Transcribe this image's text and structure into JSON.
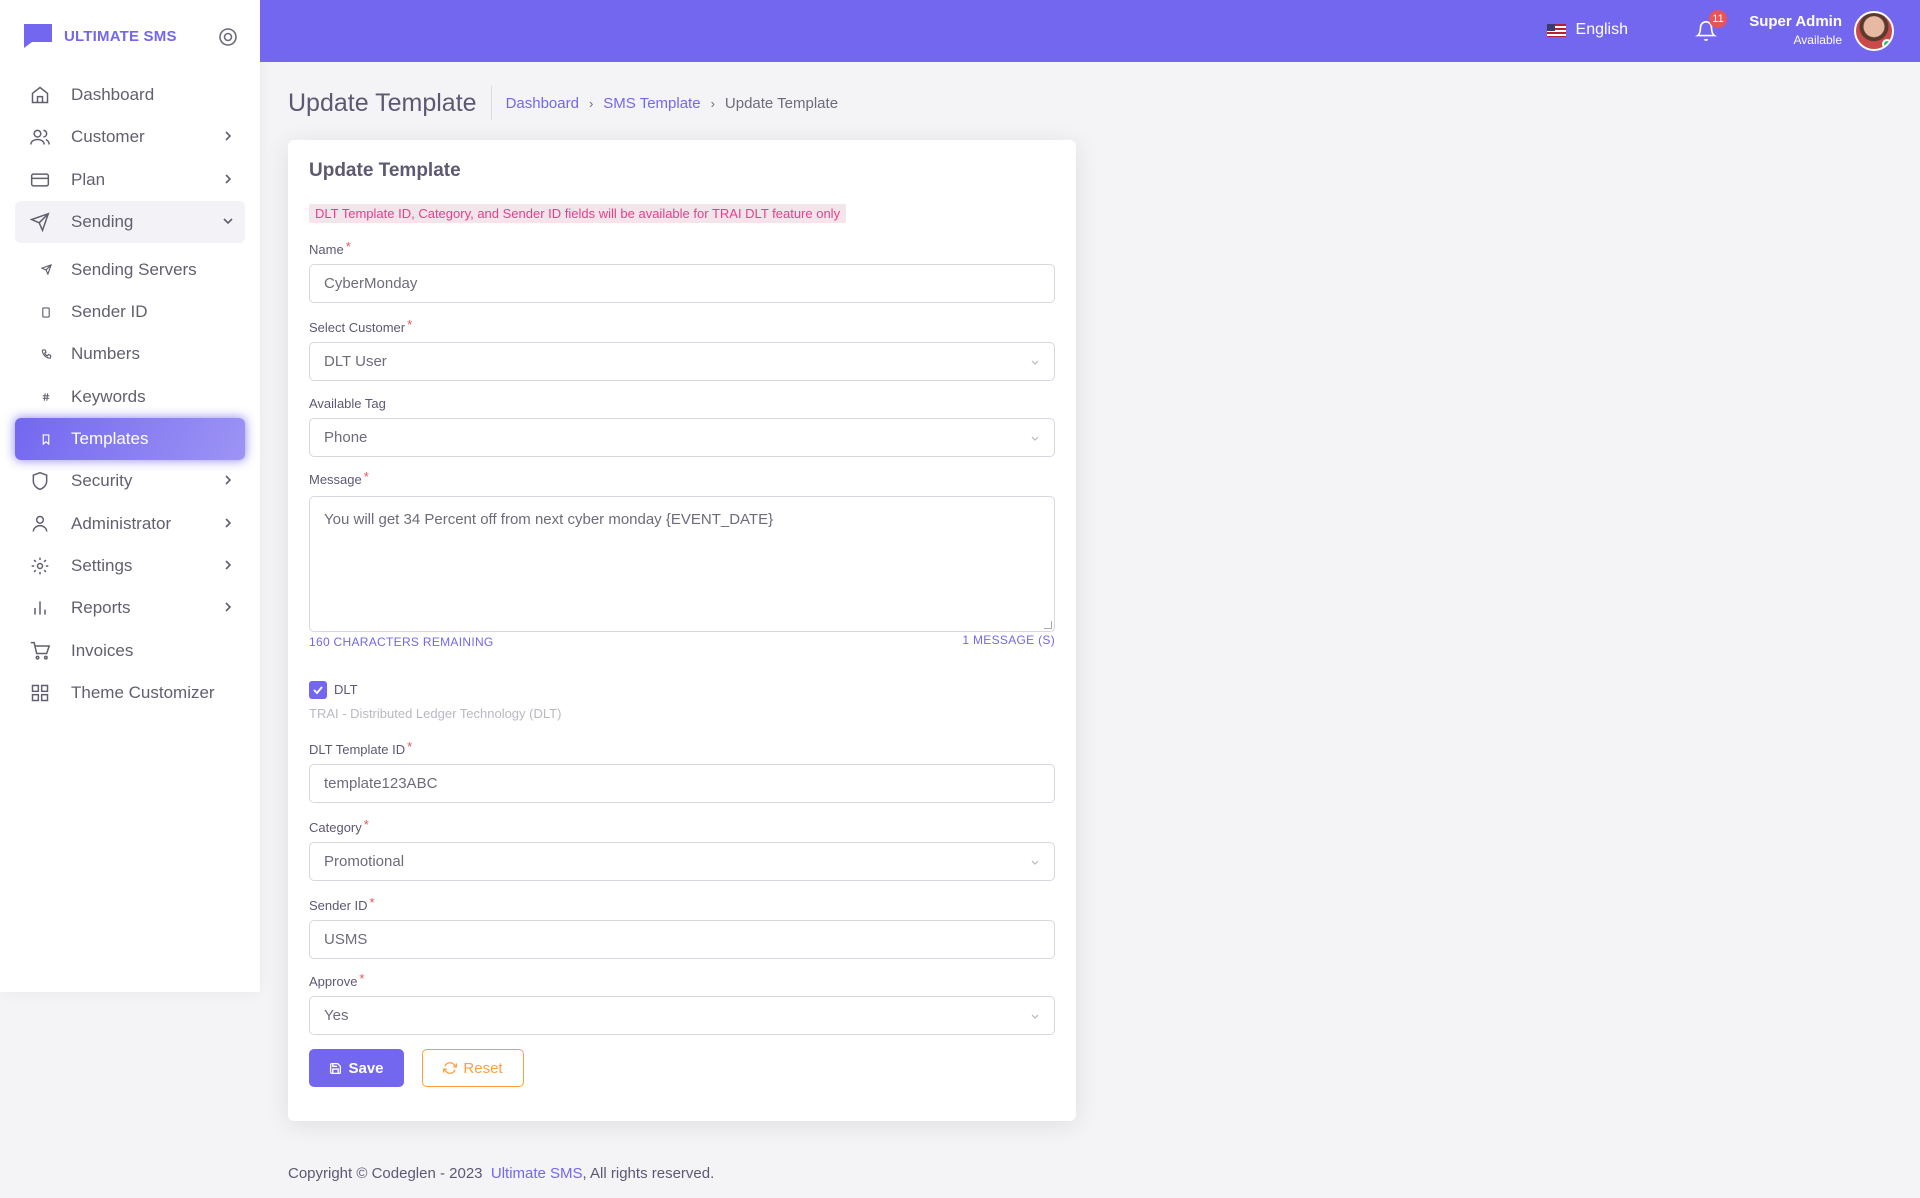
{
  "brand": {
    "name": "ULTIMATE SMS"
  },
  "sidebar": {
    "items": [
      {
        "label": "Dashboard",
        "icon": "home-icon",
        "has_chevron": false
      },
      {
        "label": "Customer",
        "icon": "users-icon",
        "has_chevron": true
      },
      {
        "label": "Plan",
        "icon": "credit-card-icon",
        "has_chevron": true
      },
      {
        "label": "Sending",
        "icon": "send-icon",
        "has_chevron": true,
        "expanded": true
      },
      {
        "label": "Sending Servers",
        "icon": "send-small-icon",
        "sub": true
      },
      {
        "label": "Sender ID",
        "icon": "tablet-icon",
        "sub": true
      },
      {
        "label": "Numbers",
        "icon": "phone-icon",
        "sub": true
      },
      {
        "label": "Keywords",
        "icon": "hash-icon",
        "sub": true
      },
      {
        "label": "Templates",
        "icon": "bookmark-icon",
        "sub": true,
        "active": true
      },
      {
        "label": "Security",
        "icon": "shield-icon",
        "has_chevron": true
      },
      {
        "label": "Administrator",
        "icon": "user-icon",
        "has_chevron": true
      },
      {
        "label": "Settings",
        "icon": "gear-icon",
        "has_chevron": true
      },
      {
        "label": "Reports",
        "icon": "bar-chart-icon",
        "has_chevron": true
      },
      {
        "label": "Invoices",
        "icon": "shopping-cart-icon",
        "has_chevron": false
      },
      {
        "label": "Theme Customizer",
        "icon": "grid-icon",
        "has_chevron": false
      }
    ]
  },
  "header": {
    "language": "English",
    "notification_count": "11",
    "user_name": "Super Admin",
    "user_status": "Available"
  },
  "page": {
    "title": "Update Template",
    "breadcrumb": [
      "Dashboard",
      "SMS Template",
      "Update Template"
    ]
  },
  "form": {
    "card_title": "Update Template",
    "notice": "DLT Template ID, Category, and Sender ID fields will be available for TRAI DLT feature only",
    "name_label": "Name",
    "name_value": "CyberMonday",
    "customer_label": "Select Customer",
    "customer_value": "DLT User",
    "tag_label": "Available Tag",
    "tag_value": "Phone",
    "message_label": "Message",
    "message_value": "You will get 34 Percent off from next cyber monday {EVENT_DATE}",
    "chars_remaining": "160 CHARACTERS REMAINING",
    "message_count": "1 MESSAGE (S)",
    "dlt_checked": true,
    "dlt_label": "DLT",
    "dlt_help": "TRAI - Distributed Ledger Technology (DLT)",
    "dlt_template_label": "DLT Template ID",
    "dlt_template_value": "template123ABC",
    "category_label": "Category",
    "category_value": "Promotional",
    "sender_label": "Sender ID",
    "sender_value": "USMS",
    "approve_label": "Approve",
    "approve_value": "Yes",
    "save_label": "Save",
    "reset_label": "Reset"
  },
  "footer": {
    "prefix": "Copyright © Codeglen - 2023",
    "link": "Ultimate SMS",
    "suffix": ", All rights reserved."
  },
  "colors": {
    "primary": "#7367f0",
    "danger": "#ea5455",
    "warning": "#ff9f43",
    "notice_text": "#e83e8c"
  }
}
